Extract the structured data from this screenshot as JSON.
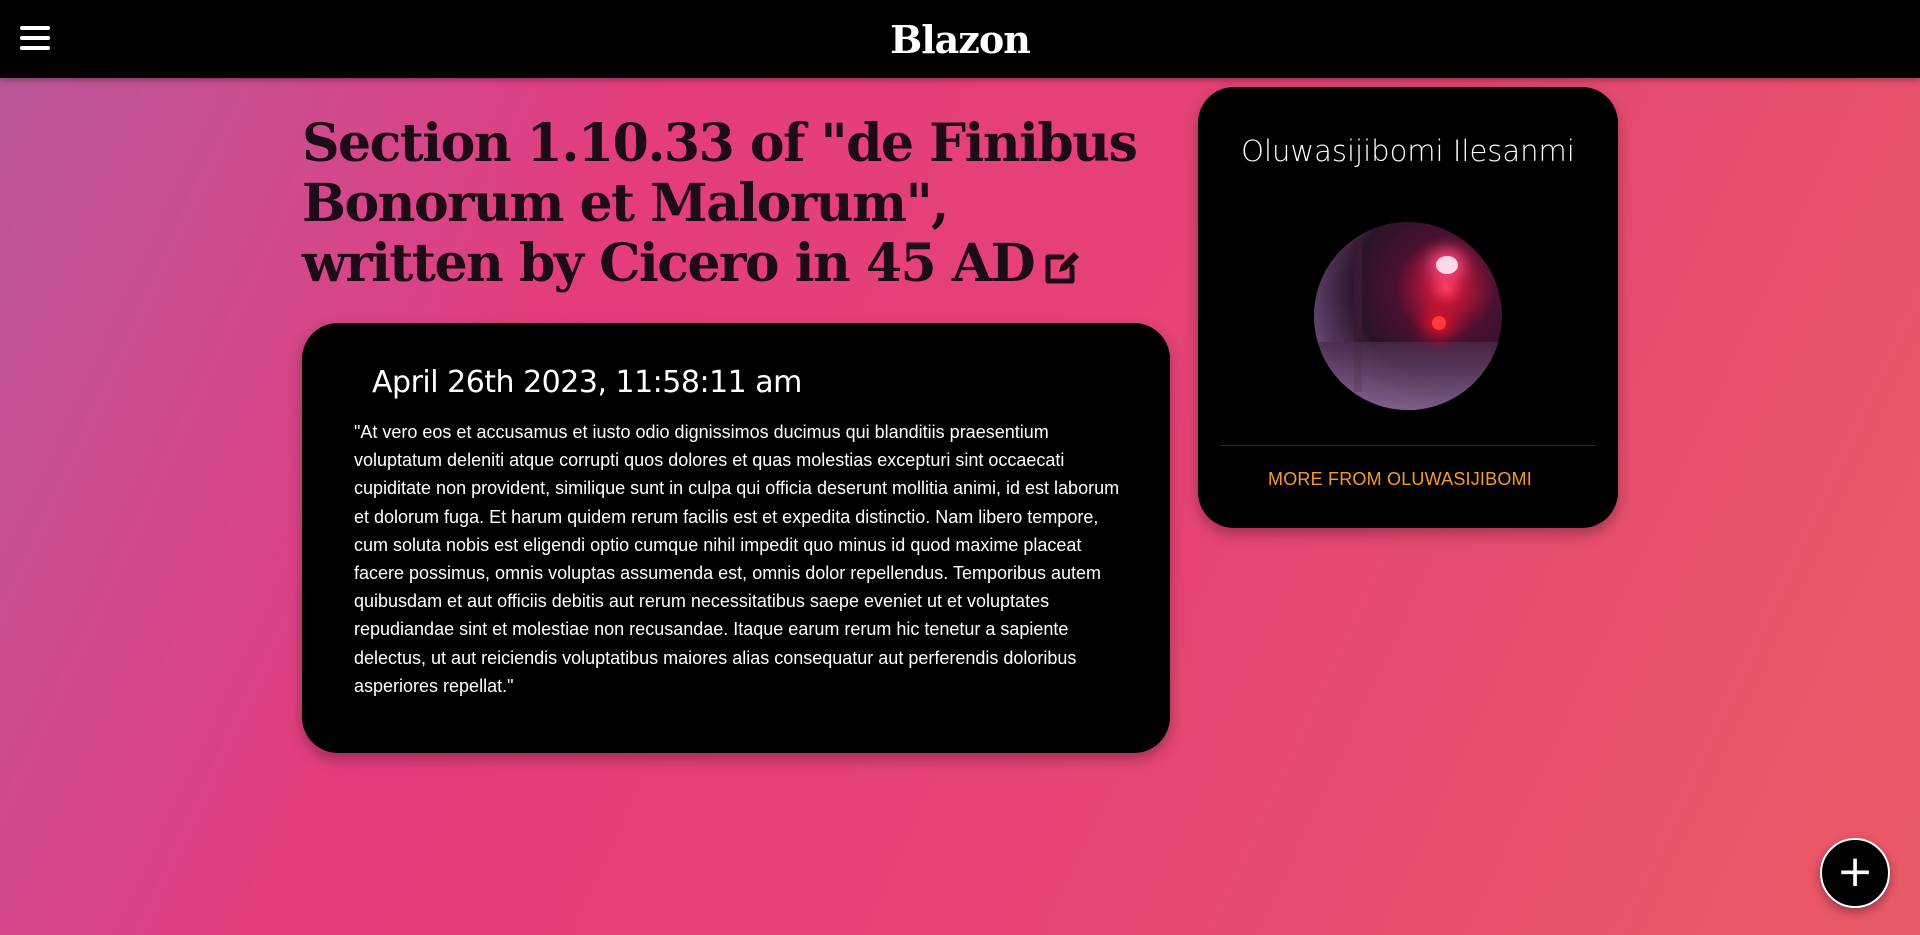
{
  "header": {
    "brand": "Blazon",
    "menu_icon": "hamburger-menu-icon"
  },
  "post": {
    "title": "Section 1.10.33 of \"de Finibus Bonorum et Malorum\", written by Cicero in 45 AD",
    "edit_icon": "edit-pencil-icon",
    "date": "April 26th 2023, 11:58:11 am",
    "body": "\"At vero eos et accusamus et iusto odio dignissimos ducimus qui blanditiis praesentium voluptatum deleniti atque corrupti quos dolores et quas molestias excepturi sint occaecati cupiditate non provident, similique sunt in culpa qui officia deserunt mollitia animi, id est laborum et dolorum fuga. Et harum quidem rerum facilis est et expedita distinctio. Nam libero tempore, cum soluta nobis est eligendi optio cumque nihil impedit quo minus id quod maxime placeat facere possimus, omnis voluptas assumenda est, omnis dolor repellendus. Temporibus autem quibusdam et aut officiis debitis aut rerum necessitatibus saepe eveniet ut et voluptates repudiandae sint et molestiae non recusandae. Itaque earum rerum hic tenetur a sapiente delectus, ut aut reiciendis voluptatibus maiores alias consequatur aut perferendis doloribus asperiores repellat.\""
  },
  "author": {
    "name": "Oluwasijibomi Ilesanmi",
    "more_link": "MORE FROM OLUWASIJIBOMI"
  },
  "fab": {
    "label": "+",
    "icon": "plus-icon"
  },
  "colors": {
    "accent_link": "#f39b2e",
    "card_bg": "#000000",
    "title_text": "#1f0a18"
  }
}
